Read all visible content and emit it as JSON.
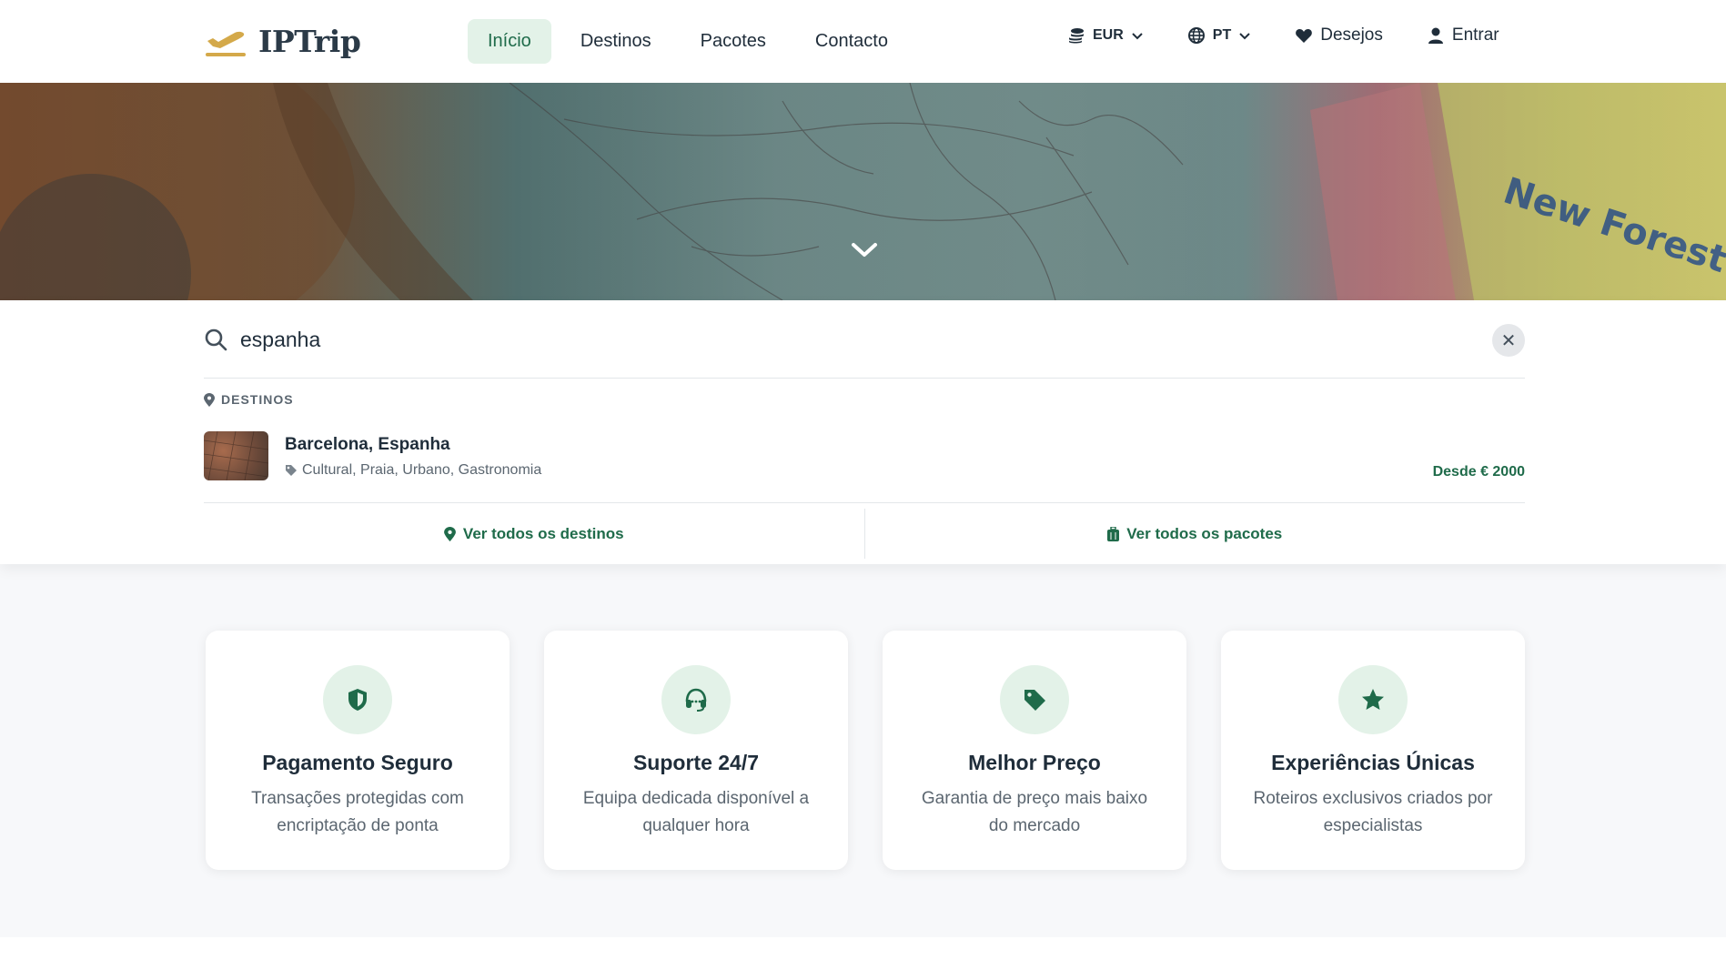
{
  "brand": {
    "name": "IPTrip"
  },
  "nav": {
    "items": [
      {
        "label": "Início",
        "active": true
      },
      {
        "label": "Destinos",
        "active": false
      },
      {
        "label": "Pacotes",
        "active": false
      },
      {
        "label": "Contacto",
        "active": false
      }
    ]
  },
  "header_right": {
    "currency": "EUR",
    "language": "PT",
    "wishlist": "Desejos",
    "login": "Entrar"
  },
  "search": {
    "value": "espanha",
    "section_label": "DESTINOS",
    "results": [
      {
        "title": "Barcelona, Espanha",
        "tags": "Cultural, Praia, Urbano, Gastronomia",
        "price": "Desde € 2000"
      }
    ],
    "view_all_destinations": "Ver todos os destinos",
    "view_all_packages": "Ver todos os pacotes"
  },
  "features": [
    {
      "icon": "shield-icon",
      "title": "Pagamento Seguro",
      "desc": "Transações protegidas com encriptação de ponta"
    },
    {
      "icon": "headset-icon",
      "title": "Suporte 24/7",
      "desc": "Equipa dedicada disponível a qualquer hora"
    },
    {
      "icon": "tag-icon",
      "title": "Melhor Preço",
      "desc": "Garantia de preço mais baixo do mercado"
    },
    {
      "icon": "star-icon",
      "title": "Experiências Únicas",
      "desc": "Roteiros exclusivos criados por especialistas"
    }
  ],
  "colors": {
    "accent": "#1f6b4a",
    "accent_soft": "#e3f2e8",
    "logo_gold": "#d4a94a"
  }
}
